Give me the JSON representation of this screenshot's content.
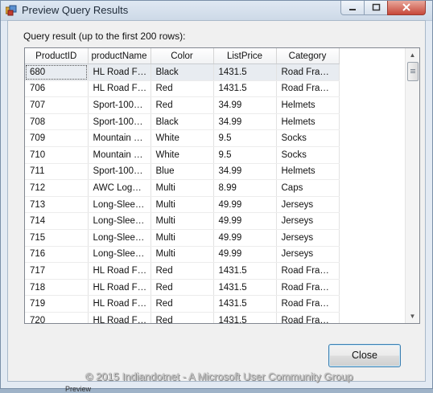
{
  "window": {
    "title": "Preview Query Results"
  },
  "dialog": {
    "query_label": "Query result (up to the first 200 rows):",
    "close_label": "Close"
  },
  "grid": {
    "columns": [
      "ProductID",
      "productName",
      "Color",
      "ListPrice",
      "Category"
    ],
    "rows": [
      [
        "680",
        "HL Road F…",
        "Black",
        "1431.5",
        "Road Fra…"
      ],
      [
        "706",
        "HL Road F…",
        "Red",
        "1431.5",
        "Road Fra…"
      ],
      [
        "707",
        "Sport-100…",
        "Red",
        "34.99",
        "Helmets"
      ],
      [
        "708",
        "Sport-100…",
        "Black",
        "34.99",
        "Helmets"
      ],
      [
        "709",
        "Mountain …",
        "White",
        "9.5",
        "Socks"
      ],
      [
        "710",
        "Mountain …",
        "White",
        "9.5",
        "Socks"
      ],
      [
        "711",
        "Sport-100…",
        "Blue",
        "34.99",
        "Helmets"
      ],
      [
        "712",
        "AWC Log…",
        "Multi",
        "8.99",
        "Caps"
      ],
      [
        "713",
        "Long-Slee…",
        "Multi",
        "49.99",
        "Jerseys"
      ],
      [
        "714",
        "Long-Slee…",
        "Multi",
        "49.99",
        "Jerseys"
      ],
      [
        "715",
        "Long-Slee…",
        "Multi",
        "49.99",
        "Jerseys"
      ],
      [
        "716",
        "Long-Slee…",
        "Multi",
        "49.99",
        "Jerseys"
      ],
      [
        "717",
        "HL Road F…",
        "Red",
        "1431.5",
        "Road Fra…"
      ],
      [
        "718",
        "HL Road F…",
        "Red",
        "1431.5",
        "Road Fra…"
      ],
      [
        "719",
        "HL Road F…",
        "Red",
        "1431.5",
        "Road Fra…"
      ],
      [
        "720",
        "HL Road F…",
        "Red",
        "1431.5",
        "Road Fra…"
      ]
    ]
  },
  "watermark": "© 2015 Indiandotnet - A Microsoft User Community Group",
  "bottom_tab": "Preview"
}
